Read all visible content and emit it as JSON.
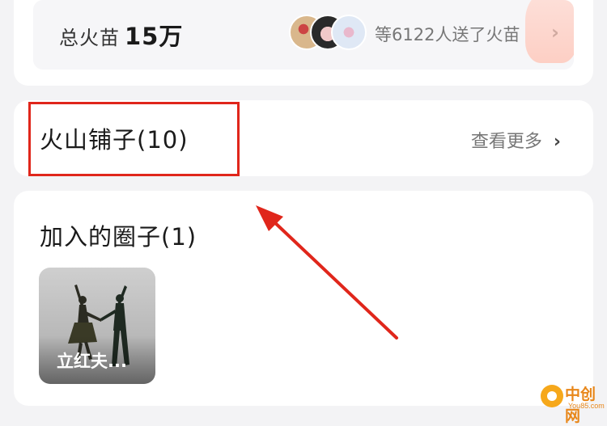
{
  "fire": {
    "label": "总火苗",
    "value": "15万",
    "donors_text": "等6122人送了火苗",
    "chevron": "›"
  },
  "shop": {
    "title": "火山铺子(10)",
    "more_label": "查看更多",
    "chevron": "›"
  },
  "circles": {
    "title": "加入的圈子(1)",
    "items": [
      {
        "label": "立红夫..."
      }
    ]
  },
  "watermark": {
    "text": "中创网",
    "sub": "You85.com"
  },
  "colors": {
    "annotation_red": "#e0261b",
    "brand_orange": "#e8871a"
  }
}
